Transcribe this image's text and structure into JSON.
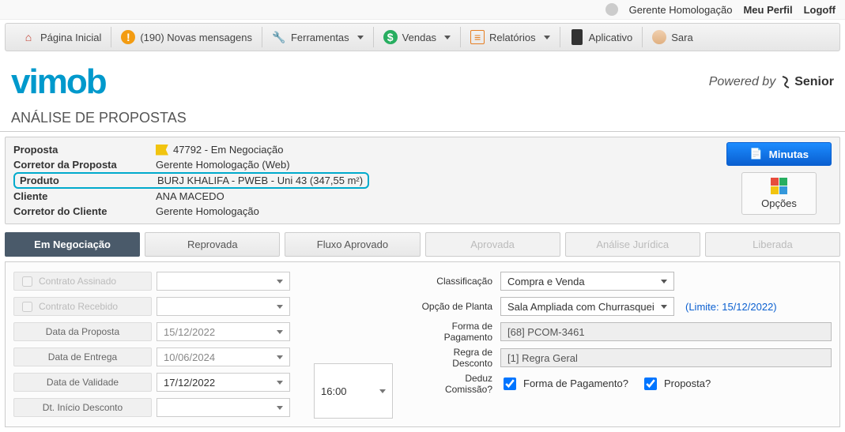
{
  "topbar": {
    "user_name": "Gerente Homologação",
    "profile_link": "Meu Perfil",
    "logoff_link": "Logoff"
  },
  "menu": {
    "home": "Página Inicial",
    "messages": "(190) Novas mensagens",
    "tools": "Ferramentas",
    "sales": "Vendas",
    "reports": "Relatórios",
    "app": "Aplicativo",
    "sara": "Sara"
  },
  "brand": {
    "logo_text": "vimob",
    "powered_label": "Powered by",
    "powered_brand": "Senior"
  },
  "page": {
    "title": "ANÁLISE DE PROPOSTAS"
  },
  "info": {
    "proposta_label": "Proposta",
    "proposta_value": "47792 - Em Negociação",
    "corretor_proposta_label": "Corretor da Proposta",
    "corretor_proposta_value": "Gerente Homologação (Web)",
    "produto_label": "Produto",
    "produto_value": "BURJ KHALIFA - PWEB - Uni 43 (347,55 m²)",
    "cliente_label": "Cliente",
    "cliente_value": "ANA MACEDO",
    "corretor_cliente_label": "Corretor do Cliente",
    "corretor_cliente_value": "Gerente Homologação"
  },
  "actions": {
    "minutas": "Minutas",
    "opcoes": "Opções"
  },
  "tabs": {
    "negociacao": "Em Negociação",
    "reprovada": "Reprovada",
    "fluxo": "Fluxo Aprovado",
    "aprovada": "Aprovada",
    "juridica": "Análise Jurídica",
    "liberada": "Liberada"
  },
  "form_left": {
    "contrato_assinado": "Contrato Assinado",
    "contrato_recebido": "Contrato Recebido",
    "data_proposta_label": "Data da Proposta",
    "data_proposta_value": "15/12/2022",
    "data_entrega_label": "Data de Entrega",
    "data_entrega_value": "10/06/2024",
    "data_validade_label": "Data de Validade",
    "data_validade_value": "17/12/2022",
    "dt_inicio_label": "Dt. Início Desconto",
    "hora_validade": "16:00"
  },
  "form_right": {
    "classificacao_label": "Classificação",
    "classificacao_value": "Compra e Venda",
    "opcao_planta_label": "Opção de Planta",
    "opcao_planta_value": "Sala Ampliada com Churrasquei",
    "limite_text": "(Limite: 15/12/2022)",
    "forma_pag_label": "Forma de Pagamento",
    "forma_pag_value": "[68] PCOM-3461",
    "regra_desc_label": "Regra de Desconto",
    "regra_desc_value": "[1] Regra Geral",
    "deduz_label": "Deduz Comissão?",
    "chk_forma": "Forma de Pagamento?",
    "chk_proposta": "Proposta?"
  }
}
